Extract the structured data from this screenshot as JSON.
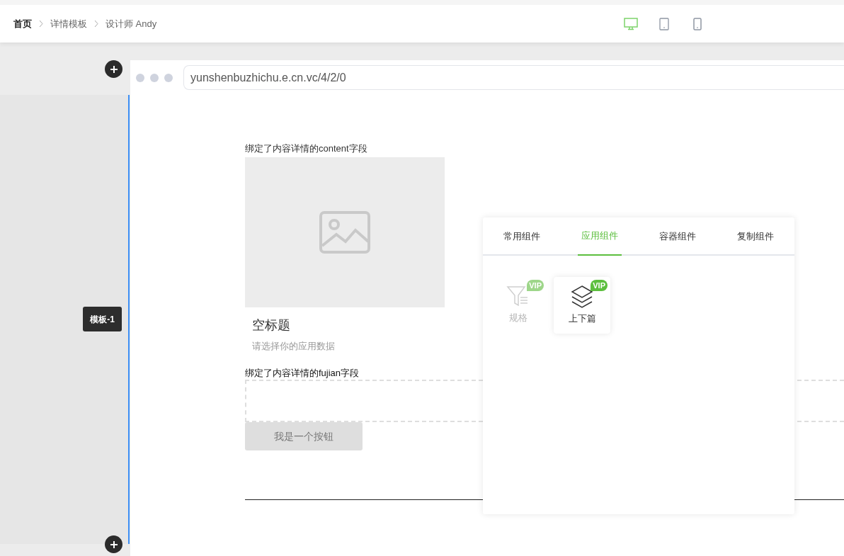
{
  "breadcrumb": [
    {
      "label": "首页",
      "current": true
    },
    {
      "label": "详情模板",
      "current": false
    },
    {
      "label": "设计师 Andy",
      "current": false
    }
  ],
  "devices": [
    {
      "kind": "desktop",
      "selected": true
    },
    {
      "kind": "tablet",
      "selected": false
    },
    {
      "kind": "phone",
      "selected": false
    }
  ],
  "browser": {
    "url": "yunshenbuzhichu.e.cn.vc/4/2/0"
  },
  "template_label": "模板-1",
  "content": {
    "content_field_label": "绑定了内容详情的content字段",
    "title": "空标题",
    "subtitle": "请选择你的应用数据",
    "fujian_field_label": "绑定了内容详情的fujian字段",
    "button": "我是一个按钮"
  },
  "component_panel": {
    "tabs": [
      {
        "label": "常用组件",
        "selected": false
      },
      {
        "label": "应用组件",
        "selected": true
      },
      {
        "label": "容器组件",
        "selected": false
      },
      {
        "label": "复制组件",
        "selected": false
      }
    ],
    "items": [
      {
        "kind": "filter",
        "label": "规格",
        "badge": "VIP",
        "disabled": true
      },
      {
        "kind": "layers",
        "label": "上下篇",
        "badge": "VIP",
        "disabled": false
      }
    ]
  }
}
